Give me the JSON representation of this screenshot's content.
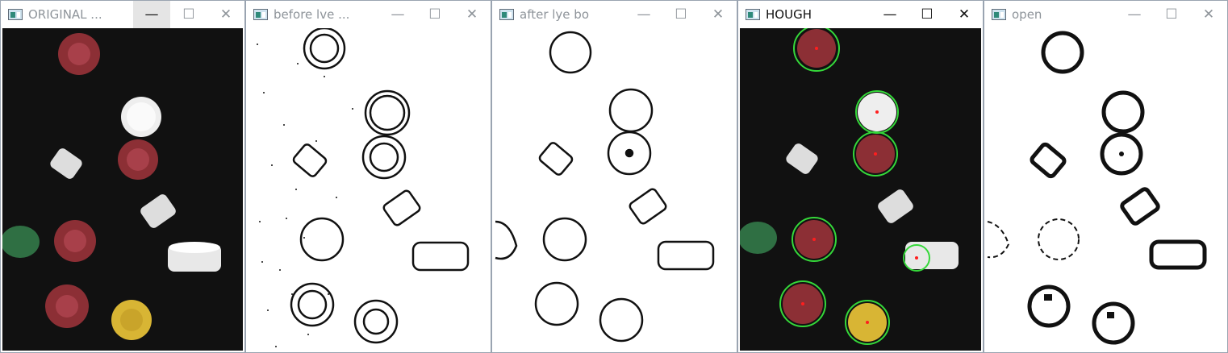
{
  "windows": [
    {
      "title": "ORIGINAL ...",
      "ctrl_min": "—",
      "ctrl_max": "☐",
      "ctrl_close": "✕"
    },
    {
      "title": "before lve ...",
      "ctrl_min": "—",
      "ctrl_max": "☐",
      "ctrl_close": "✕"
    },
    {
      "title": "after lye bo",
      "ctrl_min": "—",
      "ctrl_max": "☐",
      "ctrl_close": "✕"
    },
    {
      "title": "HOUGH",
      "ctrl_min": "—",
      "ctrl_max": "☐",
      "ctrl_close": "✕"
    },
    {
      "title": "open",
      "ctrl_min": "—",
      "ctrl_max": "☐",
      "ctrl_close": "✕"
    }
  ],
  "colors": {
    "background_dark": "#111111",
    "cap_red": "#8c2f35",
    "cap_white": "#eeeeee",
    "cap_yellow": "#d8b534",
    "cap_green": "#2f6f43",
    "hough_circle": "#35d83a",
    "hough_center": "#ff1e1e"
  }
}
